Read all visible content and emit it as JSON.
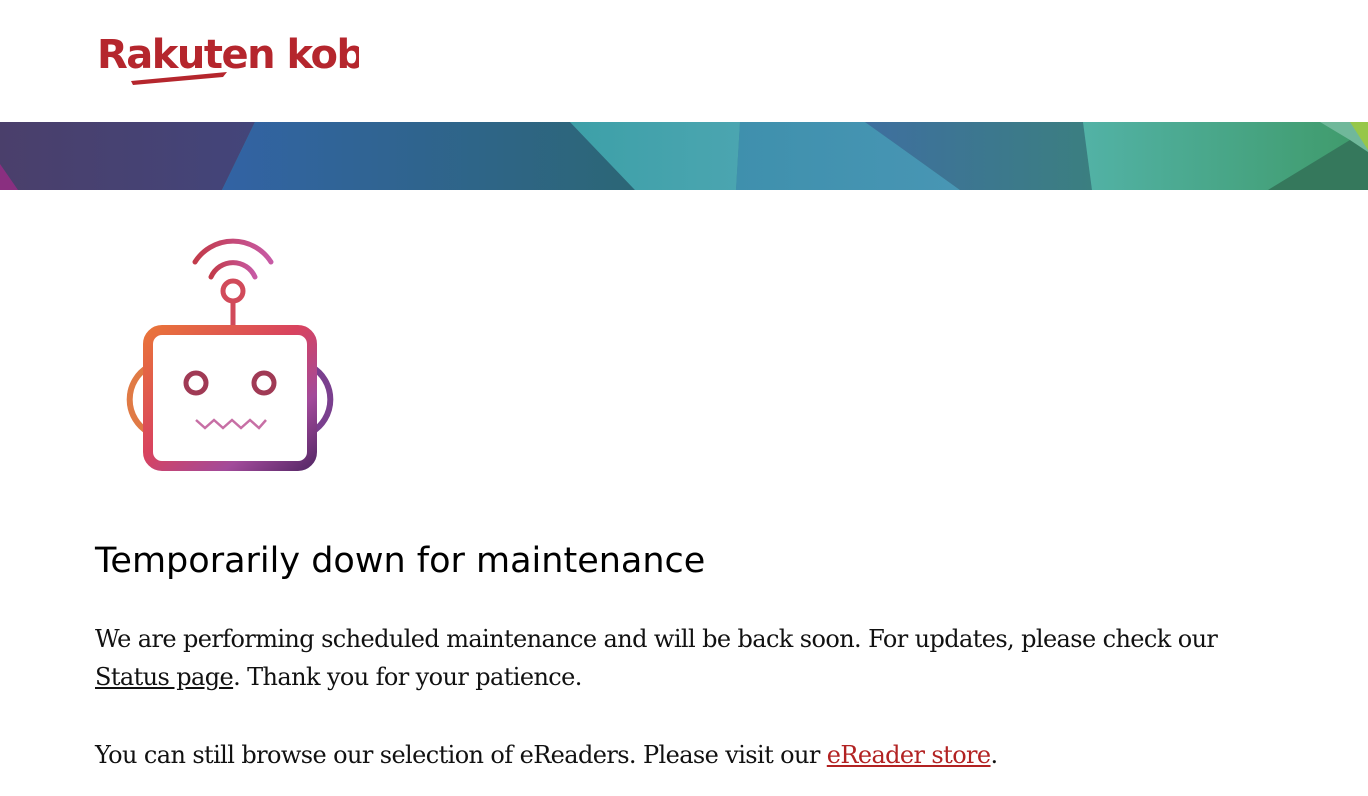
{
  "brand": {
    "name": "Rakuten kobo",
    "logo_color": "#b5262d"
  },
  "banner": {
    "colors": [
      "#47426b",
      "#2f62a0",
      "#4aa5a9",
      "#3f8fa9",
      "#55b0a2",
      "#3a7a5f"
    ]
  },
  "illustration": {
    "icon": "robot-wifi-icon"
  },
  "maintenance": {
    "title": "Temporarily down for maintenance",
    "p1_before": "We are performing scheduled maintenance and will be back soon. For updates, please check our ",
    "status_link": "Status page",
    "p1_after": ". Thank you for your patience.",
    "p2_before": "You can still browse our selection of eReaders. Please visit our ",
    "store_link": "eReader store",
    "p2_after": ".",
    "link_color": "#b22222"
  }
}
